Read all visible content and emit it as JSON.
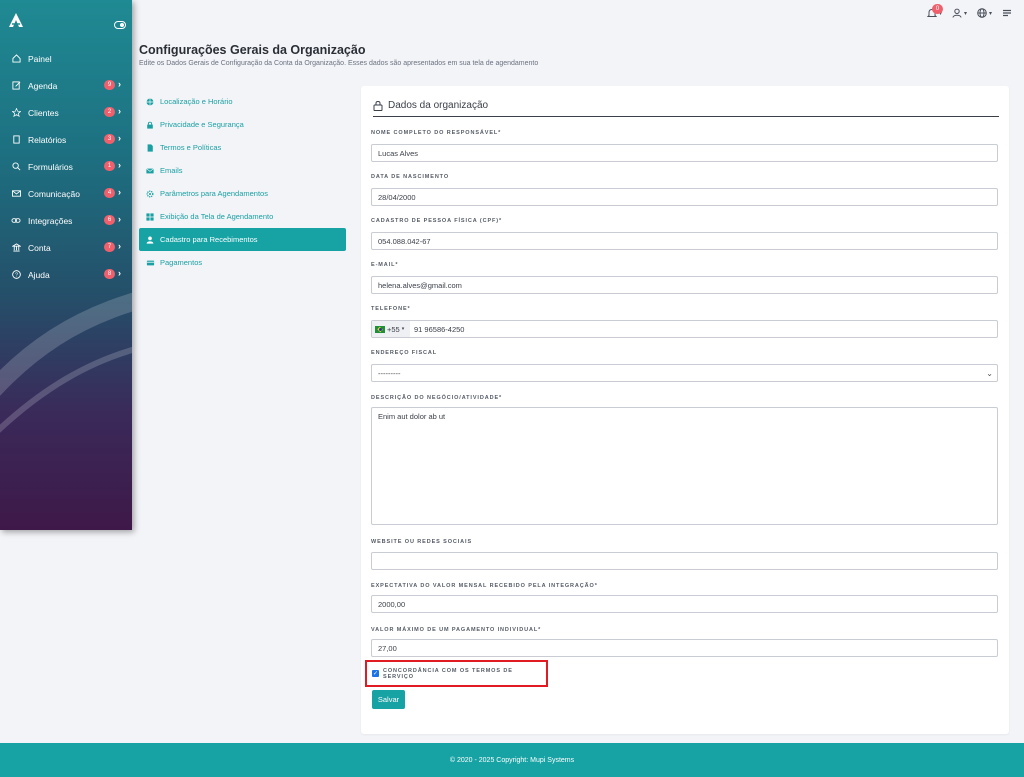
{
  "topbar": {
    "notif_count": "0"
  },
  "sidebar": {
    "items": [
      {
        "label": "Painel",
        "badge": "",
        "icon": "home-icon"
      },
      {
        "label": "Agenda",
        "badge": "9",
        "icon": "edit-icon"
      },
      {
        "label": "Clientes",
        "badge": "2",
        "icon": "star-icon"
      },
      {
        "label": "Relatórios",
        "badge": "3",
        "icon": "book-icon"
      },
      {
        "label": "Formulários",
        "badge": "1",
        "icon": "search-icon"
      },
      {
        "label": "Comunicação",
        "badge": "4",
        "icon": "mail-icon"
      },
      {
        "label": "Integrações",
        "badge": "6",
        "icon": "link-icon"
      },
      {
        "label": "Conta",
        "badge": "7",
        "icon": "bank-icon"
      },
      {
        "label": "Ajuda",
        "badge": "8",
        "icon": "help-icon"
      }
    ]
  },
  "header": {
    "title": "Configurações Gerais da Organização",
    "subtitle": "Edite os Dados Gerais de Configuração da Conta da Organização. Esses dados são apresentados em sua tela de agendamento"
  },
  "submenu": {
    "items": [
      {
        "label": "Localização e Horário"
      },
      {
        "label": "Privacidade e Segurança"
      },
      {
        "label": "Termos e Políticas"
      },
      {
        "label": "Emails"
      },
      {
        "label": "Parâmetros para Agendamentos"
      },
      {
        "label": "Exibição da Tela de Agendamento"
      },
      {
        "label": "Cadastro para Recebimentos"
      },
      {
        "label": "Pagamentos"
      }
    ]
  },
  "form": {
    "card_title": "Dados da organização",
    "fields": {
      "nome": {
        "label": "NOME COMPLETO DO RESPONSÁVEL*",
        "value": "Lucas Alves"
      },
      "nascimento": {
        "label": "DATA DE NASCIMENTO",
        "value": "28/04/2000"
      },
      "cpf": {
        "label": "CADASTRO DE PESSOA FÍSICA (CPF)*",
        "value": "054.088.042-67"
      },
      "email": {
        "label": "E-MAIL*",
        "value": "helena.alves@gmail.com"
      },
      "telefone": {
        "label": "TELEFONE*",
        "country_code": "+55",
        "value": "91 96586-4250"
      },
      "endereco": {
        "label": "ENDEREÇO FISCAL",
        "value": "---------"
      },
      "descricao": {
        "label": "DESCRIÇÃO DO NEGÓCIO/ATIVIDADE*",
        "value": "Enim aut dolor ab ut"
      },
      "website": {
        "label": "WEBSITE OU REDES SOCIAIS",
        "value": ""
      },
      "expectativa": {
        "label": "EXPECTATIVA DO VALOR MENSAL RECEBIDO PELA INTEGRAÇÃO*",
        "value": "2000,00"
      },
      "valor_max": {
        "label": "VALOR MÁXIMO DE UM PAGAMENTO INDIVIDUAL*",
        "value": "27,00"
      }
    },
    "terms_label": "CONCORDÂNCIA COM OS TERMOS DE SERVIÇO",
    "save_label": "Salvar"
  },
  "footer": {
    "text": "© 2020 - 2025 Copyright:",
    "brand": "Mupi Systems"
  },
  "colors": {
    "accent": "#17a2a4",
    "badge": "#f0606c",
    "highlight": "#e01b24"
  }
}
